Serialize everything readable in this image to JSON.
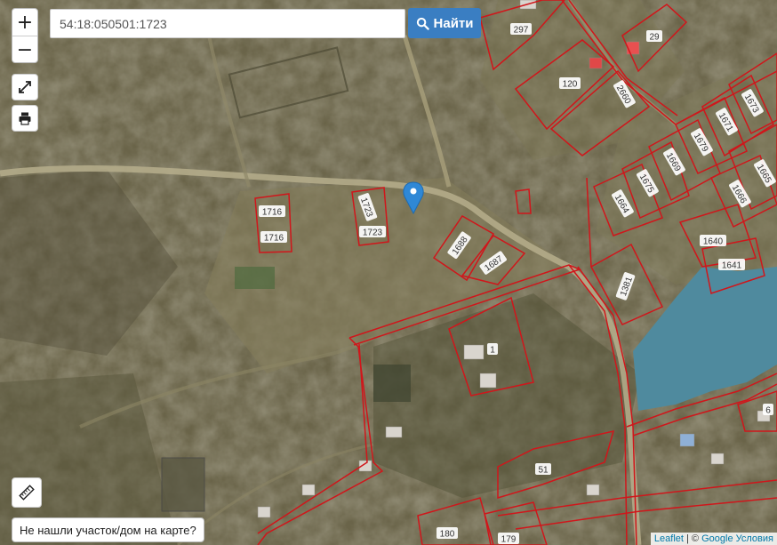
{
  "search": {
    "value": "54:18:050501:1723",
    "button_label": "Найти",
    "button_icon": "search-icon"
  },
  "controls": {
    "zoom_in": "+",
    "zoom_out": "−",
    "fullscreen_icon": "expand-icon",
    "print_icon": "printer-icon",
    "ruler_icon": "ruler-icon"
  },
  "not_found_label": "Не нашли участок/дом на карте?",
  "attribution": {
    "leaflet": "Leaflet",
    "separator": " | © ",
    "google": "Google",
    "terms": "Условия"
  },
  "marker_icon": "map-pin-icon",
  "colors": {
    "parcel_outline": "#d0161b",
    "label_bg": "#ffffff",
    "search_button": "#3a7ec2",
    "water": "#4f8a9e"
  },
  "parcels": [
    {
      "id": "p297",
      "label": "297"
    },
    {
      "id": "p29",
      "label": "29"
    },
    {
      "id": "p120",
      "label": "120"
    },
    {
      "id": "p2660",
      "label": "2660"
    },
    {
      "id": "p1673",
      "label": "1673"
    },
    {
      "id": "p1671",
      "label": "1671"
    },
    {
      "id": "p1679",
      "label": "1679"
    },
    {
      "id": "p1669",
      "label": "1669"
    },
    {
      "id": "p1665",
      "label": "1665"
    },
    {
      "id": "p1675",
      "label": "1675"
    },
    {
      "id": "p1664",
      "label": "1664"
    },
    {
      "id": "p1666",
      "label": "1666"
    },
    {
      "id": "p1640",
      "label": "1640"
    },
    {
      "id": "p1641",
      "label": "1641"
    },
    {
      "id": "p1716a",
      "label": "1716"
    },
    {
      "id": "p1716b",
      "label": "1716"
    },
    {
      "id": "p1723a",
      "label": "1723"
    },
    {
      "id": "p1723b",
      "label": "1723"
    },
    {
      "id": "p1688",
      "label": "1688"
    },
    {
      "id": "p1687",
      "label": "1687"
    },
    {
      "id": "p1381",
      "label": "1381"
    },
    {
      "id": "p1",
      "label": "1"
    },
    {
      "id": "p6",
      "label": "6"
    },
    {
      "id": "p51",
      "label": "51"
    },
    {
      "id": "p180",
      "label": "180"
    },
    {
      "id": "p179",
      "label": "179"
    }
  ]
}
